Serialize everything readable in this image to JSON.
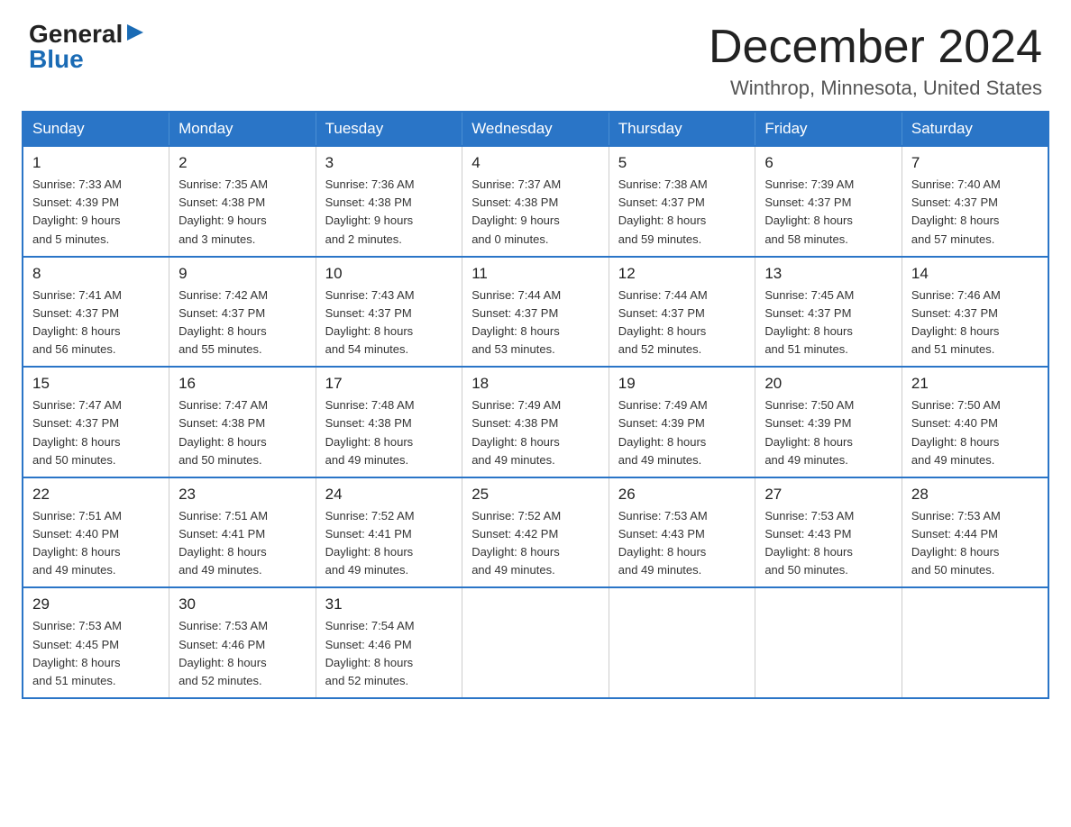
{
  "logo": {
    "general": "General",
    "blue": "Blue",
    "arrow": "▶"
  },
  "title": "December 2024",
  "subtitle": "Winthrop, Minnesota, United States",
  "days_of_week": [
    "Sunday",
    "Monday",
    "Tuesday",
    "Wednesday",
    "Thursday",
    "Friday",
    "Saturday"
  ],
  "weeks": [
    [
      {
        "day": "1",
        "sunrise": "7:33 AM",
        "sunset": "4:39 PM",
        "daylight": "9 hours and 5 minutes."
      },
      {
        "day": "2",
        "sunrise": "7:35 AM",
        "sunset": "4:38 PM",
        "daylight": "9 hours and 3 minutes."
      },
      {
        "day": "3",
        "sunrise": "7:36 AM",
        "sunset": "4:38 PM",
        "daylight": "9 hours and 2 minutes."
      },
      {
        "day": "4",
        "sunrise": "7:37 AM",
        "sunset": "4:38 PM",
        "daylight": "9 hours and 0 minutes."
      },
      {
        "day": "5",
        "sunrise": "7:38 AM",
        "sunset": "4:37 PM",
        "daylight": "8 hours and 59 minutes."
      },
      {
        "day": "6",
        "sunrise": "7:39 AM",
        "sunset": "4:37 PM",
        "daylight": "8 hours and 58 minutes."
      },
      {
        "day": "7",
        "sunrise": "7:40 AM",
        "sunset": "4:37 PM",
        "daylight": "8 hours and 57 minutes."
      }
    ],
    [
      {
        "day": "8",
        "sunrise": "7:41 AM",
        "sunset": "4:37 PM",
        "daylight": "8 hours and 56 minutes."
      },
      {
        "day": "9",
        "sunrise": "7:42 AM",
        "sunset": "4:37 PM",
        "daylight": "8 hours and 55 minutes."
      },
      {
        "day": "10",
        "sunrise": "7:43 AM",
        "sunset": "4:37 PM",
        "daylight": "8 hours and 54 minutes."
      },
      {
        "day": "11",
        "sunrise": "7:44 AM",
        "sunset": "4:37 PM",
        "daylight": "8 hours and 53 minutes."
      },
      {
        "day": "12",
        "sunrise": "7:44 AM",
        "sunset": "4:37 PM",
        "daylight": "8 hours and 52 minutes."
      },
      {
        "day": "13",
        "sunrise": "7:45 AM",
        "sunset": "4:37 PM",
        "daylight": "8 hours and 51 minutes."
      },
      {
        "day": "14",
        "sunrise": "7:46 AM",
        "sunset": "4:37 PM",
        "daylight": "8 hours and 51 minutes."
      }
    ],
    [
      {
        "day": "15",
        "sunrise": "7:47 AM",
        "sunset": "4:37 PM",
        "daylight": "8 hours and 50 minutes."
      },
      {
        "day": "16",
        "sunrise": "7:47 AM",
        "sunset": "4:38 PM",
        "daylight": "8 hours and 50 minutes."
      },
      {
        "day": "17",
        "sunrise": "7:48 AM",
        "sunset": "4:38 PM",
        "daylight": "8 hours and 49 minutes."
      },
      {
        "day": "18",
        "sunrise": "7:49 AM",
        "sunset": "4:38 PM",
        "daylight": "8 hours and 49 minutes."
      },
      {
        "day": "19",
        "sunrise": "7:49 AM",
        "sunset": "4:39 PM",
        "daylight": "8 hours and 49 minutes."
      },
      {
        "day": "20",
        "sunrise": "7:50 AM",
        "sunset": "4:39 PM",
        "daylight": "8 hours and 49 minutes."
      },
      {
        "day": "21",
        "sunrise": "7:50 AM",
        "sunset": "4:40 PM",
        "daylight": "8 hours and 49 minutes."
      }
    ],
    [
      {
        "day": "22",
        "sunrise": "7:51 AM",
        "sunset": "4:40 PM",
        "daylight": "8 hours and 49 minutes."
      },
      {
        "day": "23",
        "sunrise": "7:51 AM",
        "sunset": "4:41 PM",
        "daylight": "8 hours and 49 minutes."
      },
      {
        "day": "24",
        "sunrise": "7:52 AM",
        "sunset": "4:41 PM",
        "daylight": "8 hours and 49 minutes."
      },
      {
        "day": "25",
        "sunrise": "7:52 AM",
        "sunset": "4:42 PM",
        "daylight": "8 hours and 49 minutes."
      },
      {
        "day": "26",
        "sunrise": "7:53 AM",
        "sunset": "4:43 PM",
        "daylight": "8 hours and 49 minutes."
      },
      {
        "day": "27",
        "sunrise": "7:53 AM",
        "sunset": "4:43 PM",
        "daylight": "8 hours and 50 minutes."
      },
      {
        "day": "28",
        "sunrise": "7:53 AM",
        "sunset": "4:44 PM",
        "daylight": "8 hours and 50 minutes."
      }
    ],
    [
      {
        "day": "29",
        "sunrise": "7:53 AM",
        "sunset": "4:45 PM",
        "daylight": "8 hours and 51 minutes."
      },
      {
        "day": "30",
        "sunrise": "7:53 AM",
        "sunset": "4:46 PM",
        "daylight": "8 hours and 52 minutes."
      },
      {
        "day": "31",
        "sunrise": "7:54 AM",
        "sunset": "4:46 PM",
        "daylight": "8 hours and 52 minutes."
      },
      null,
      null,
      null,
      null
    ]
  ],
  "labels": {
    "sunrise": "Sunrise:",
    "sunset": "Sunset:",
    "daylight": "Daylight:"
  },
  "colors": {
    "header_bg": "#2a75c7",
    "header_text": "#ffffff",
    "border": "#2a75c7",
    "logo_blue": "#1a6bb5"
  }
}
